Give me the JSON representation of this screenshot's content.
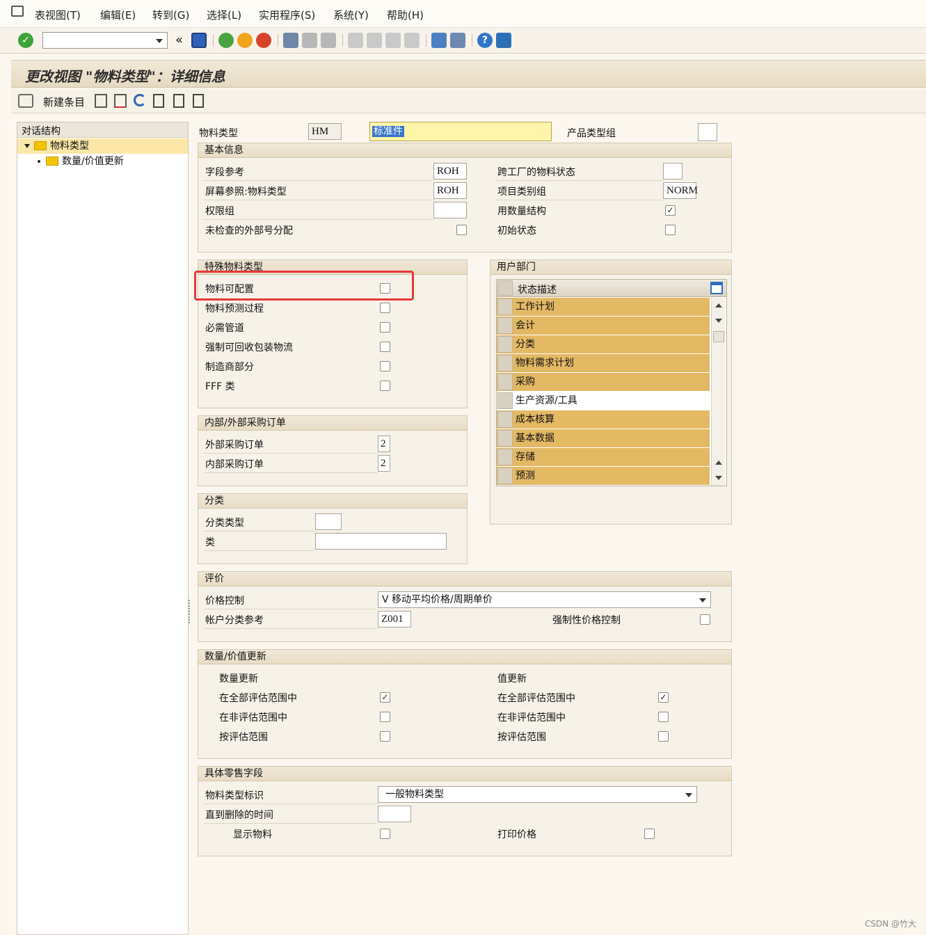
{
  "menu": {
    "items": [
      "表视图(T)",
      "编辑(E)",
      "转到(G)",
      "选择(L)",
      "实用程序(S)",
      "系统(Y)",
      "帮助(H)"
    ]
  },
  "toolbar": {
    "nav_arrow": "«"
  },
  "title": "更改视图 \"物料类型\"：详细信息",
  "apptoolbar": {
    "new_entries": "新建条目"
  },
  "tree": {
    "header": "对话结构",
    "items": [
      {
        "label": "物料类型",
        "selected": true
      },
      {
        "label": "数量/价值更新",
        "selected": false
      }
    ]
  },
  "header_fields": {
    "material_type_label": "物料类型",
    "material_type_value": "HM",
    "material_type_desc": "标准件",
    "product_type_group_label": "产品类型组",
    "product_type_group_value": ""
  },
  "basic": {
    "title": "基本信息",
    "field_ref_label": "字段参考",
    "field_ref_value": "ROH",
    "screen_ref_label": "屏幕参照:物料类型",
    "screen_ref_value": "ROH",
    "auth_group_label": "权限组",
    "auth_group_value": "",
    "ext_no_label": "未检查的外部号分配",
    "ext_no_checked": false,
    "cross_plant_label": "跨工厂的物料状态",
    "cross_plant_value": "",
    "item_cat_label": "项目类别组",
    "item_cat_value": "NORM",
    "qty_struct_label": "用数量结构",
    "qty_struct_checked": true,
    "initial_status_label": "初始状态",
    "initial_status_checked": false
  },
  "special": {
    "title": "特殊物料类型",
    "items": [
      {
        "label": "物料可配置",
        "checked": false
      },
      {
        "label": "物料预测过程",
        "checked": false
      },
      {
        "label": "必需管道",
        "checked": false
      },
      {
        "label": "强制可回收包装物流",
        "checked": false
      },
      {
        "label": "制造商部分",
        "checked": false
      },
      {
        "label": "FFF 类",
        "checked": false
      }
    ]
  },
  "purch": {
    "title": "内部/外部采购订单",
    "ext_label": "外部采购订单",
    "ext_value": "2",
    "int_label": "内部采购订单",
    "int_value": "2"
  },
  "classif": {
    "title": "分类",
    "type_label": "分类类型",
    "type_value": "",
    "class_label": "类",
    "class_value": ""
  },
  "user_dept": {
    "title": "用户部门",
    "col_header": "状态描述",
    "rows": [
      {
        "text": "工作计划",
        "highlight": true
      },
      {
        "text": "会计",
        "highlight": true
      },
      {
        "text": "分类",
        "highlight": true
      },
      {
        "text": "物料需求计划",
        "highlight": true
      },
      {
        "text": "采购",
        "highlight": true
      },
      {
        "text": "生产资源/工具",
        "highlight": false
      },
      {
        "text": "成本核算",
        "highlight": true
      },
      {
        "text": "基本数据",
        "highlight": true
      },
      {
        "text": "存储",
        "highlight": true
      },
      {
        "text": "预测",
        "highlight": true
      }
    ]
  },
  "valuation": {
    "title": "评价",
    "price_ctrl_label": "价格控制",
    "price_ctrl_value": "V 移动平均价格/周期单价",
    "acct_cat_label": "帐户分类参考",
    "acct_cat_value": "Z001",
    "forced_label": "强制性价格控制",
    "forced_checked": false
  },
  "qty_value": {
    "title": "数量/价值更新",
    "qty_header": "数量更新",
    "val_header": "值更新",
    "rows": [
      {
        "qty_label": "在全部评估范围中",
        "qty_checked": true,
        "val_label": "在全部评估范围中",
        "val_checked": true
      },
      {
        "qty_label": "在非评估范围中",
        "qty_checked": false,
        "val_label": "在非评估范围中",
        "val_checked": false
      },
      {
        "qty_label": "按评估范围",
        "qty_checked": false,
        "val_label": "按评估范围",
        "val_checked": false
      }
    ]
  },
  "retail": {
    "title": "具体零售字段",
    "mat_type_id_label": "物料类型标识",
    "mat_type_id_value": "一般物料类型",
    "until_del_label": "直到删除的时间",
    "until_del_value": "",
    "display_label": "显示物料",
    "display_checked": false,
    "print_price_label": "打印价格",
    "print_price_checked": false
  },
  "watermark": "CSDN @竹大",
  "colors": {
    "highlight": "#e3b964",
    "annotation": "#e53935",
    "desc_field": "#fff5a8"
  }
}
